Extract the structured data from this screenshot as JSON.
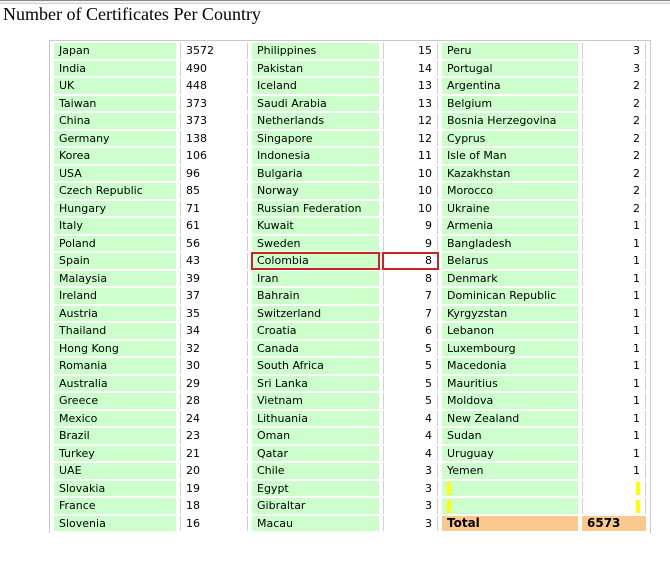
{
  "page_title": "Number of Certificates Per Country",
  "col1": [
    {
      "country": "Japan",
      "count": "3572"
    },
    {
      "country": "India",
      "count": "490"
    },
    {
      "country": "UK",
      "count": "448"
    },
    {
      "country": "Taiwan",
      "count": "373"
    },
    {
      "country": "China",
      "count": "373"
    },
    {
      "country": "Germany",
      "count": "138"
    },
    {
      "country": "Korea",
      "count": "106"
    },
    {
      "country": "USA",
      "count": "96"
    },
    {
      "country": "Czech Republic",
      "count": "85"
    },
    {
      "country": "Hungary",
      "count": "71"
    },
    {
      "country": "Italy",
      "count": "61"
    },
    {
      "country": "Poland",
      "count": "56"
    },
    {
      "country": "Spain",
      "count": "43"
    },
    {
      "country": "Malaysia",
      "count": "39"
    },
    {
      "country": "Ireland",
      "count": "37"
    },
    {
      "country": "Austria",
      "count": "35"
    },
    {
      "country": "Thailand",
      "count": "34"
    },
    {
      "country": "Hong Kong",
      "count": "32"
    },
    {
      "country": "Romania",
      "count": "30"
    },
    {
      "country": "Australia",
      "count": "29"
    },
    {
      "country": "Greece",
      "count": "28"
    },
    {
      "country": "Mexico",
      "count": "24"
    },
    {
      "country": "Brazil",
      "count": "23"
    },
    {
      "country": "Turkey",
      "count": "21"
    },
    {
      "country": "UAE",
      "count": "20"
    },
    {
      "country": "Slovakia",
      "count": "19"
    },
    {
      "country": "France",
      "count": "18"
    },
    {
      "country": "Slovenia",
      "count": "16"
    }
  ],
  "col2": [
    {
      "country": "Philippines",
      "count": "15"
    },
    {
      "country": "Pakistan",
      "count": "14"
    },
    {
      "country": "Iceland",
      "count": "13"
    },
    {
      "country": "Saudi Arabia",
      "count": "13"
    },
    {
      "country": "Netherlands",
      "count": "12"
    },
    {
      "country": "Singapore",
      "count": "12"
    },
    {
      "country": "Indonesia",
      "count": "11"
    },
    {
      "country": "Bulgaria",
      "count": "10"
    },
    {
      "country": "Norway",
      "count": "10"
    },
    {
      "country": "Russian Federation",
      "count": "10"
    },
    {
      "country": "Kuwait",
      "count": "9"
    },
    {
      "country": "Sweden",
      "count": "9"
    },
    {
      "country": "Colombia",
      "count": "8"
    },
    {
      "country": "Iran",
      "count": "8"
    },
    {
      "country": "Bahrain",
      "count": "7"
    },
    {
      "country": "Switzerland",
      "count": "7"
    },
    {
      "country": "Croatia",
      "count": "6"
    },
    {
      "country": "Canada",
      "count": "5"
    },
    {
      "country": "South Africa",
      "count": "5"
    },
    {
      "country": "Sri Lanka",
      "count": "5"
    },
    {
      "country": "Vietnam",
      "count": "5"
    },
    {
      "country": "Lithuania",
      "count": "4"
    },
    {
      "country": "Oman",
      "count": "4"
    },
    {
      "country": "Qatar",
      "count": "4"
    },
    {
      "country": "Chile",
      "count": "3"
    },
    {
      "country": "Egypt",
      "count": "3"
    },
    {
      "country": "Gibraltar",
      "count": "3"
    },
    {
      "country": "Macau",
      "count": "3"
    }
  ],
  "col3": [
    {
      "country": "Peru",
      "count": "3"
    },
    {
      "country": "Portugal",
      "count": "3"
    },
    {
      "country": "Argentina",
      "count": "2"
    },
    {
      "country": "Belgium",
      "count": "2"
    },
    {
      "country": "Bosnia Herzegovina",
      "count": "2"
    },
    {
      "country": "Cyprus",
      "count": "2"
    },
    {
      "country": "Isle of Man",
      "count": "2"
    },
    {
      "country": "Kazakhstan",
      "count": "2"
    },
    {
      "country": "Morocco",
      "count": "2"
    },
    {
      "country": "Ukraine",
      "count": "2"
    },
    {
      "country": "Armenia",
      "count": "1"
    },
    {
      "country": "Bangladesh",
      "count": "1"
    },
    {
      "country": "Belarus",
      "count": "1"
    },
    {
      "country": "Denmark",
      "count": "1"
    },
    {
      "country": "Dominican Republic",
      "count": "1"
    },
    {
      "country": "Kyrgyzstan",
      "count": "1"
    },
    {
      "country": "Lebanon",
      "count": "1"
    },
    {
      "country": "Luxembourg",
      "count": "1"
    },
    {
      "country": "Macedonia",
      "count": "1"
    },
    {
      "country": "Mauritius",
      "count": "1"
    },
    {
      "country": "Moldova",
      "count": "1"
    },
    {
      "country": "New Zealand",
      "count": "1"
    },
    {
      "country": "Sudan",
      "count": "1"
    },
    {
      "country": "Uruguay",
      "count": "1"
    },
    {
      "country": "Yemen",
      "count": "1"
    }
  ],
  "total": {
    "label": "Total",
    "value": "6573"
  },
  "colors": {
    "country_cell": "#ccffcc",
    "total_cell": "#fbc98d",
    "selection": "#cc2222",
    "empty_marker": "#ffff00"
  },
  "selected_cell": "Colombia"
}
